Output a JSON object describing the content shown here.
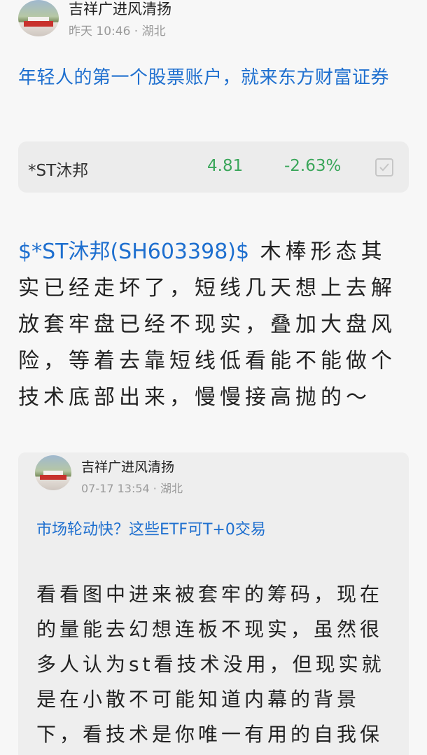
{
  "post": {
    "author": "吉祥广进风清扬",
    "meta": "昨天 10:46 · 湖北",
    "ad_title": "年轻人的第一个股票账户，就来东方财富证券",
    "stock": {
      "name": "*ST沐邦",
      "price": "4.81",
      "change": "-2.63%",
      "color": "#3aa65a"
    },
    "stock_link": "$*ST沐邦(SH603398)$",
    "body": " 木棒形态其实已经走坏了，短线几天想上去解放套牢盘已经不现实，叠加大盘风险，等着去靠短线低看能不能做个技术底部出来，慢慢接高抛的～"
  },
  "quoted": {
    "author": "吉祥广进风清扬",
    "meta": "07-17 13:54 · 湖北",
    "ad_title": "市场轮动快？这些ETF可T+0交易",
    "body": "看看图中进来被套牢的筹码，现在的量能去幻想连板不现实，虽然很多人认为st看技术没用，但现实就是在小散不可能知道内幕的背景下，看技术是你唯一有用的自我保"
  },
  "colors": {
    "link": "#1e6fcf",
    "gain_down": "#3aa65a",
    "card_bg": "#ececec"
  }
}
